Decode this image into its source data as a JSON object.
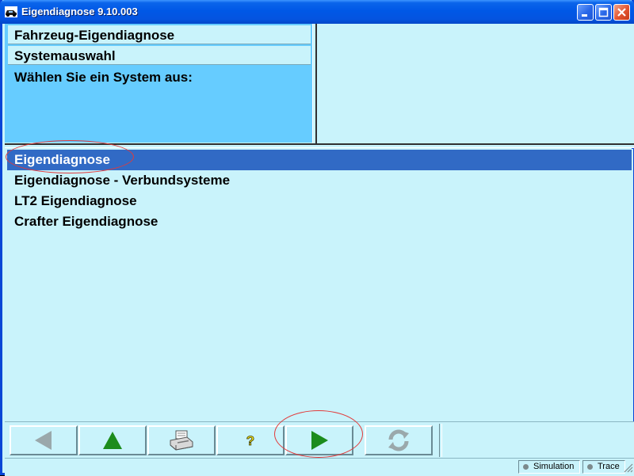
{
  "window": {
    "title": "Eigendiagnose 9.10.003",
    "icon": "car-icon"
  },
  "header": {
    "rows": [
      "Fahrzeug-Eigendiagnose",
      "Systemauswahl"
    ],
    "prompt": "Wählen Sie ein System aus:"
  },
  "list": {
    "items": [
      {
        "label": "Eigendiagnose",
        "selected": true
      },
      {
        "label": "Eigendiagnose - Verbundsysteme",
        "selected": false
      },
      {
        "label": "LT2 Eigendiagnose",
        "selected": false
      },
      {
        "label": "Crafter Eigendiagnose",
        "selected": false
      }
    ]
  },
  "toolbar": {
    "buttons": [
      {
        "icon": "back-arrow-icon",
        "enabled": false
      },
      {
        "icon": "up-arrow-icon",
        "enabled": true
      },
      {
        "icon": "printer-icon",
        "enabled": true
      },
      {
        "icon": "help-icon",
        "enabled": true,
        "glyph": "?"
      },
      {
        "icon": "forward-arrow-icon",
        "enabled": true
      },
      {
        "icon": "refresh-icon",
        "enabled": false
      }
    ]
  },
  "status": {
    "simulation": "Simulation",
    "trace": "Trace"
  },
  "colors": {
    "background": "#c9f3fb",
    "prompt_background": "#66ccff",
    "selection": "#316ac5",
    "arrow_green": "#1c8c1c",
    "annotation_red": "#e23a3a"
  }
}
